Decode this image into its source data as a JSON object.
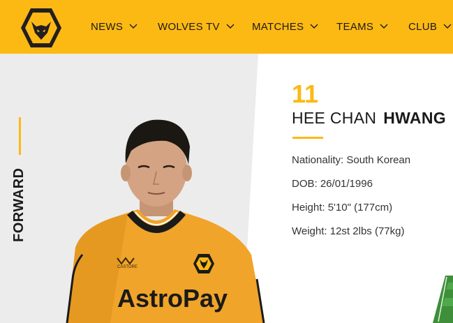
{
  "header": {
    "brand": "Wolves",
    "nav": [
      {
        "label": "NEWS",
        "icon": "chevron-down-icon"
      },
      {
        "label": "WOLVES TV",
        "icon": "chevron-down-icon"
      },
      {
        "label": "MATCHES",
        "icon": "chevron-down-icon"
      },
      {
        "label": "TEAMS",
        "icon": "chevron-down-icon"
      },
      {
        "label": "CLUB",
        "icon": "chevron-down-icon"
      }
    ]
  },
  "player": {
    "position": "FORWARD",
    "number": "11",
    "first_name": "HEE CHAN",
    "last_name": "HWANG",
    "details": {
      "nationality": "Nationality: South Korean",
      "dob": "DOB: 26/01/1996",
      "height": "Height: 5'10\" (177cm)",
      "weight": "Weight: 12st 2lbs (77kg)"
    },
    "shirt_sponsor": "AstroPay",
    "kit_brand": "CASTORE"
  },
  "colors": {
    "gold": "#fdb913",
    "black": "#1a1a1a",
    "panel_grey": "#ececec"
  }
}
